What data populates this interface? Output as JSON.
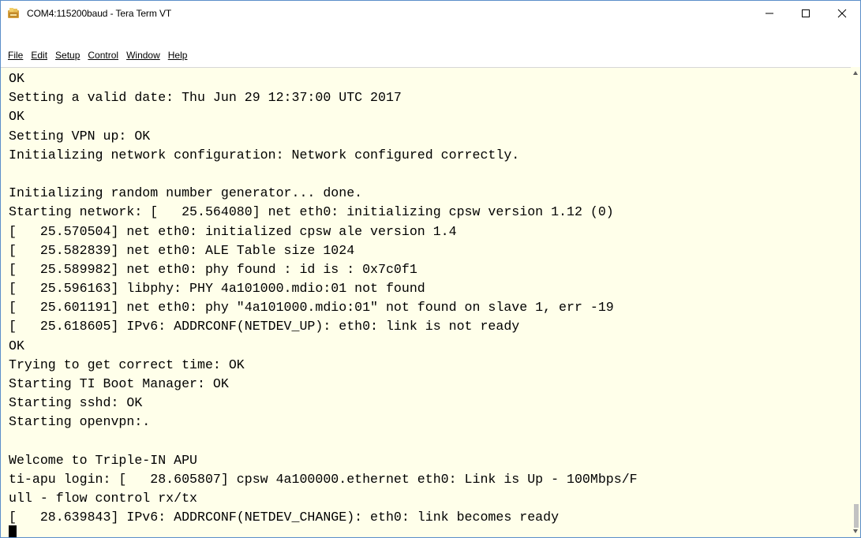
{
  "window": {
    "title": "COM4:115200baud - Tera Term VT",
    "minimize_symbol": "—",
    "maximize_symbol": "☐",
    "close_symbol": "✕"
  },
  "menu": {
    "items": [
      {
        "label": "File"
      },
      {
        "label": "Edit"
      },
      {
        "label": "Setup"
      },
      {
        "label": "Control"
      },
      {
        "label": "Window"
      },
      {
        "label": "Help"
      }
    ]
  },
  "terminal": {
    "background": "#ffffea",
    "lines": [
      "OK",
      "Setting a valid date: Thu Jun 29 12:37:00 UTC 2017",
      "OK",
      "Setting VPN up: OK",
      "Initializing network configuration: Network configured correctly.",
      "",
      "Initializing random number generator... done.",
      "Starting network: [   25.564080] net eth0: initializing cpsw version 1.12 (0)",
      "[   25.570504] net eth0: initialized cpsw ale version 1.4",
      "[   25.582839] net eth0: ALE Table size 1024",
      "[   25.589982] net eth0: phy found : id is : 0x7c0f1",
      "[   25.596163] libphy: PHY 4a101000.mdio:01 not found",
      "[   25.601191] net eth0: phy \"4a101000.mdio:01\" not found on slave 1, err -19",
      "[   25.618605] IPv6: ADDRCONF(NETDEV_UP): eth0: link is not ready",
      "OK",
      "Trying to get correct time: OK",
      "Starting TI Boot Manager: OK",
      "Starting sshd: OK",
      "Starting openvpn:.",
      "",
      "Welcome to Triple-IN APU",
      "ti-apu login: [   28.605807] cpsw 4a100000.ethernet eth0: Link is Up - 100Mbps/F",
      "ull - flow control rx/tx",
      "[   28.639843] IPv6: ADDRCONF(NETDEV_CHANGE): eth0: link becomes ready"
    ]
  }
}
